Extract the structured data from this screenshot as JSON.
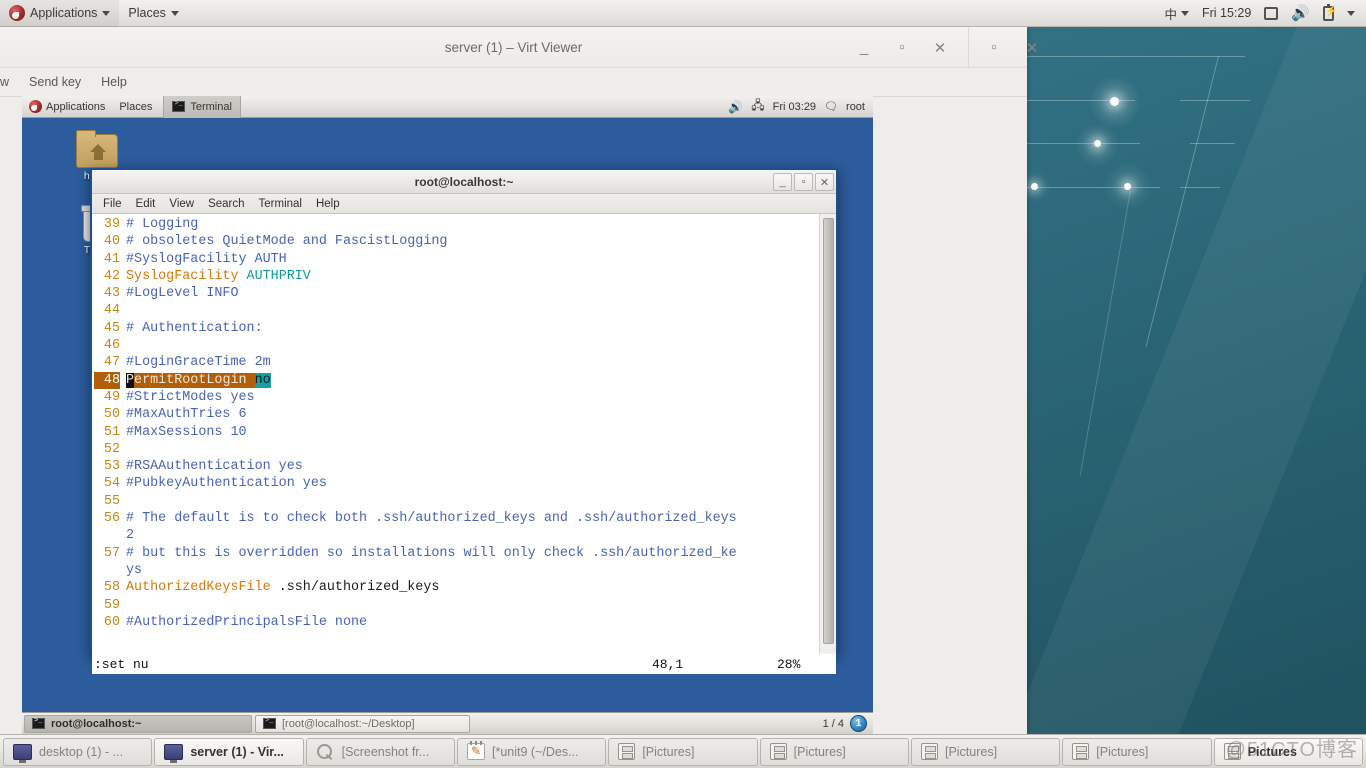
{
  "host": {
    "top_panel": {
      "applications_label": "Applications",
      "places_label": "Places",
      "input_method": "中",
      "clock": "Fri 15:29"
    },
    "taskbar_items": [
      {
        "label": "desktop (1) - ...",
        "icon": "monitor-icon",
        "state": "inactive"
      },
      {
        "label": "server (1) - Vir...",
        "icon": "monitor-icon",
        "state": "active"
      },
      {
        "label": "[Screenshot fr...",
        "icon": "magnifier-icon",
        "state": "inactive"
      },
      {
        "label": "[*unit9 (~/Des...",
        "icon": "note-icon",
        "state": "inactive"
      },
      {
        "label": "[Pictures]",
        "icon": "drawer-icon",
        "state": "inactive"
      },
      {
        "label": "[Pictures]",
        "icon": "drawer-icon",
        "state": "inactive"
      },
      {
        "label": "[Pictures]",
        "icon": "drawer-icon",
        "state": "inactive"
      },
      {
        "label": "[Pictures]",
        "icon": "drawer-icon",
        "state": "inactive"
      },
      {
        "label": "Pictures",
        "icon": "drawer-icon",
        "state": "active"
      }
    ],
    "watermark": "@51CTO博客"
  },
  "virt_viewer": {
    "title": "server (1) – Virt Viewer",
    "menus": [
      "w",
      "Send key",
      "Help"
    ],
    "window_buttons": {
      "minimize": "_",
      "maximize": "▫",
      "close": "✕"
    },
    "outer_buttons": {
      "maximize": "▫",
      "close": "✕"
    }
  },
  "vm": {
    "top_panel": {
      "applications_label": "Applications",
      "places_label": "Places",
      "active_task": "Terminal",
      "clock": "Fri 03:29",
      "user": "root"
    },
    "desktop_icons": [
      {
        "label": "home",
        "icon": "home-folder-icon"
      },
      {
        "label": "Trash",
        "icon": "trash-icon"
      }
    ],
    "bottom_panel": {
      "tasks": [
        {
          "label": "root@localhost:~",
          "state": "active"
        },
        {
          "label": "[root@localhost:~/Desktop]",
          "state": "inactive"
        }
      ],
      "workspace_label": "1 / 4",
      "workspace_badge": "1"
    }
  },
  "terminal": {
    "title": "root@localhost:~",
    "menus": [
      "File",
      "Edit",
      "View",
      "Search",
      "Terminal",
      "Help"
    ],
    "window_buttons": {
      "minimize": "_",
      "maximize": "▫",
      "close": "✕"
    },
    "status": {
      "command": ":set nu",
      "position": "48,1",
      "percent": "28%"
    },
    "lines": [
      {
        "n": "39",
        "parts": [
          {
            "t": "# Logging",
            "c": "cmt"
          }
        ]
      },
      {
        "n": "40",
        "parts": [
          {
            "t": "# obsoletes QuietMode and FascistLogging",
            "c": "cmt"
          }
        ]
      },
      {
        "n": "41",
        "parts": [
          {
            "t": "#SyslogFacility AUTH",
            "c": "cmt"
          }
        ]
      },
      {
        "n": "42",
        "parts": [
          {
            "t": "SyslogFacility ",
            "c": "kw"
          },
          {
            "t": "AUTHPRIV",
            "c": "val"
          }
        ]
      },
      {
        "n": "43",
        "parts": [
          {
            "t": "#LogLevel INFO",
            "c": "cmt"
          }
        ]
      },
      {
        "n": "44",
        "parts": []
      },
      {
        "n": "45",
        "parts": [
          {
            "t": "# Authentication:",
            "c": "cmt"
          }
        ]
      },
      {
        "n": "46",
        "parts": []
      },
      {
        "n": "47",
        "parts": [
          {
            "t": "#LoginGraceTime 2m",
            "c": "cmt"
          }
        ]
      },
      {
        "n": "48",
        "cursor": true,
        "parts": [
          {
            "t": "P",
            "c": "cur-block"
          },
          {
            "t": "ermitRootLogin",
            "c": "cur-text"
          },
          {
            "t": " ",
            "c": "cur-text"
          },
          {
            "t": "no",
            "c": "cur-val"
          }
        ]
      },
      {
        "n": "49",
        "parts": [
          {
            "t": "#StrictModes yes",
            "c": "cmt"
          }
        ]
      },
      {
        "n": "50",
        "parts": [
          {
            "t": "#MaxAuthTries 6",
            "c": "cmt"
          }
        ]
      },
      {
        "n": "51",
        "parts": [
          {
            "t": "#MaxSessions 10",
            "c": "cmt"
          }
        ]
      },
      {
        "n": "52",
        "parts": []
      },
      {
        "n": "53",
        "parts": [
          {
            "t": "#RSAAuthentication yes",
            "c": "cmt"
          }
        ]
      },
      {
        "n": "54",
        "parts": [
          {
            "t": "#PubkeyAuthentication yes",
            "c": "cmt"
          }
        ]
      },
      {
        "n": "55",
        "parts": []
      },
      {
        "n": "56",
        "parts": [
          {
            "t": "# The default is to check both .ssh/authorized_keys and .ssh/authorized_keys",
            "c": "cmt"
          }
        ]
      },
      {
        "n": "",
        "parts": [
          {
            "t": "2",
            "c": "cmt"
          }
        ]
      },
      {
        "n": "57",
        "parts": [
          {
            "t": "# but this is overridden so installations will only check .ssh/authorized_ke",
            "c": "cmt"
          }
        ]
      },
      {
        "n": "",
        "parts": [
          {
            "t": "ys",
            "c": "cmt"
          }
        ]
      },
      {
        "n": "58",
        "parts": [
          {
            "t": "AuthorizedKeysFile ",
            "c": "kw"
          },
          {
            "t": ".ssh/authorized_keys",
            "c": "plain"
          }
        ]
      },
      {
        "n": "59",
        "parts": []
      },
      {
        "n": "60",
        "parts": [
          {
            "t": "#AuthorizedPrincipalsFile none",
            "c": "cmt"
          }
        ]
      }
    ]
  }
}
